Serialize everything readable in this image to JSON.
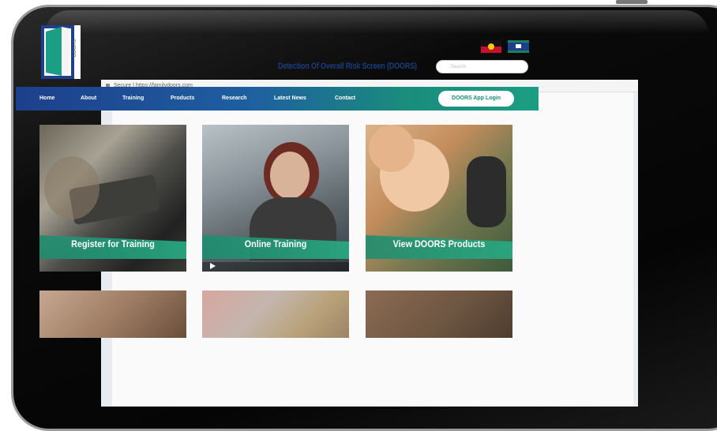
{
  "browser": {
    "address_text": "Secure | https://familydoors.com"
  },
  "header": {
    "logo_text": "DOORS",
    "title": "Detection Of Overall Risk Screen (DOORS)",
    "search_placeholder": "Search"
  },
  "nav": {
    "items": [
      "Home",
      "About",
      "Training",
      "Products",
      "Research",
      "Latest News",
      "Contact"
    ],
    "login_label": "DOORS App Login"
  },
  "tiles": [
    {
      "label": "Register for Training"
    },
    {
      "label": "Online Training"
    },
    {
      "label": "View DOORS Products"
    },
    {
      "label": ""
    },
    {
      "label": ""
    },
    {
      "label": ""
    }
  ],
  "colors": {
    "nav_start": "#1d3f8c",
    "nav_end": "#1b9e84",
    "ribbon": "#1c8c6e",
    "title_text": "#1b3d7d"
  },
  "icons": [
    "lock-icon",
    "search-icon",
    "play-icon",
    "aboriginal-flag-icon",
    "torres-strait-flag-icon",
    "doors-logo"
  ]
}
